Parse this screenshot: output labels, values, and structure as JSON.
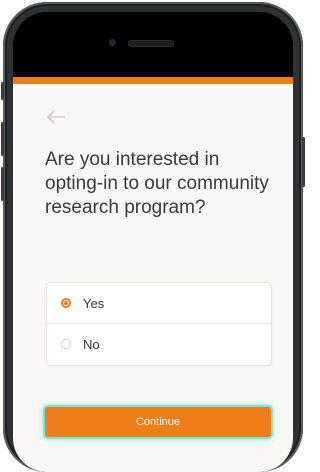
{
  "screen": {
    "question": "Are you interested in opting-in to our community research program?",
    "back_icon": "arrow-left-icon"
  },
  "options": [
    {
      "label": "Yes",
      "selected": true
    },
    {
      "label": "No",
      "selected": false
    }
  ],
  "continue_label": "Continue",
  "colors": {
    "accent": "#ef7d1a",
    "focus_ring": "#7fe3cf",
    "background": "#faf8f6"
  }
}
